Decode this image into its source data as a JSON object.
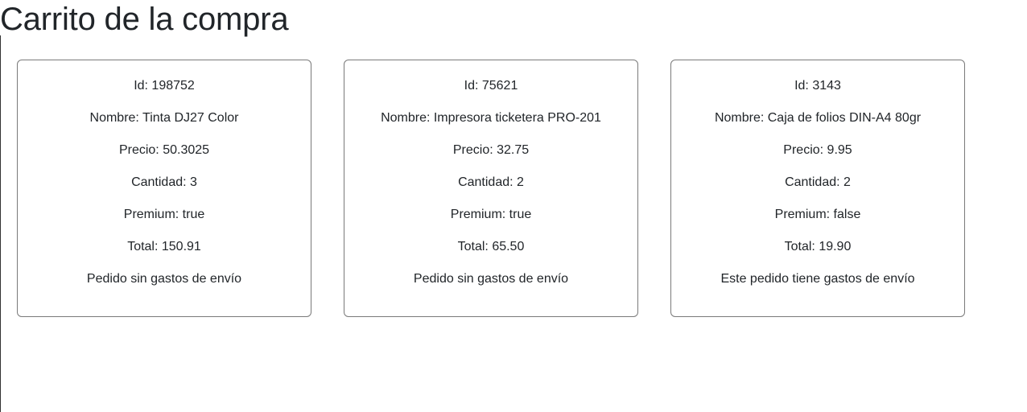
{
  "page": {
    "title": "Carrito de la compra"
  },
  "cart": {
    "items": [
      {
        "id": "Id: 198752",
        "nombre": "Nombre: Tinta DJ27 Color",
        "precio": "Precio: 50.3025",
        "cantidad": "Cantidad: 3",
        "premium": "Premium: true",
        "total": "Total: 150.91",
        "envio": "Pedido sin gastos de envío"
      },
      {
        "id": "Id: 75621",
        "nombre": "Nombre: Impresora ticketera PRO-201",
        "precio": "Precio: 32.75",
        "cantidad": "Cantidad: 2",
        "premium": "Premium: true",
        "total": "Total: 65.50",
        "envio": "Pedido sin gastos de envío"
      },
      {
        "id": "Id: 3143",
        "nombre": "Nombre: Caja de folios DIN-A4 80gr",
        "precio": "Precio: 9.95",
        "cantidad": "Cantidad: 2",
        "premium": "Premium: false",
        "total": "Total: 19.90",
        "envio": "Este pedido tiene gastos de envío"
      }
    ]
  }
}
